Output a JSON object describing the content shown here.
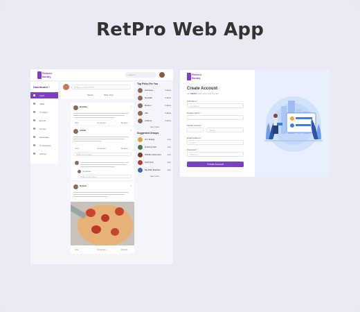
{
  "headline": "RetPro Web App",
  "feed": {
    "logo_text": "Retired Buddy",
    "search_placeholder": "Search...",
    "sidebar_title": "Dashboard",
    "sidebar_items": [
      "Feed",
      "Walls",
      "Contacts",
      "Events",
      "Groups",
      "Messages",
      "Connections",
      "Setting"
    ],
    "post_placeholder": "Whats on your mind?",
    "post_actions": [
      "Media",
      "Write Post"
    ],
    "posts": [
      {
        "author": "Bradley",
        "likes": "Like",
        "comment": "Comment",
        "repost": "Repost",
        "comment_placeholder": "Write a comment..."
      },
      {
        "author": "Alfinia",
        "likes": "Like",
        "comment": "Comment",
        "repost": "Repost",
        "comment_placeholder": "Write a comment...",
        "reply_author": "Jonathan"
      },
      {
        "author": "Rowan",
        "likes": "Like",
        "comment": "Comment",
        "repost": "Repost"
      }
    ],
    "top_picks_title": "Top Picks For You",
    "top_picks": [
      "Garnetta",
      "Nevidah",
      "Bruhun",
      "Alle",
      "Andrew"
    ],
    "follow_label": "Follow",
    "suggested_title": "Suggested Groups",
    "groups": [
      "Our Buddy",
      "Knitting Club",
      "Wildlife Adventure",
      "Golf Club",
      "Big Bike Buddies"
    ],
    "join_label": "Join",
    "see_more": "See more"
  },
  "account": {
    "logo_text": "Retired Buddy",
    "title": "Create Account",
    "subtitle_prefix": "join",
    "subtitle_brand": "RetPro",
    "subtitle_suffix": "and meet new friends!",
    "fields": [
      {
        "label": "Full Name *",
        "placeholder": "Full Name"
      },
      {
        "label": "Display Name *",
        "placeholder": ""
      },
      {
        "label": "Mobile Number *",
        "placeholder": "Mobile"
      },
      {
        "label": "Email Address *",
        "placeholder": "Email"
      },
      {
        "label": "Password *",
        "placeholder": "Password"
      }
    ],
    "button": "Create Account"
  }
}
